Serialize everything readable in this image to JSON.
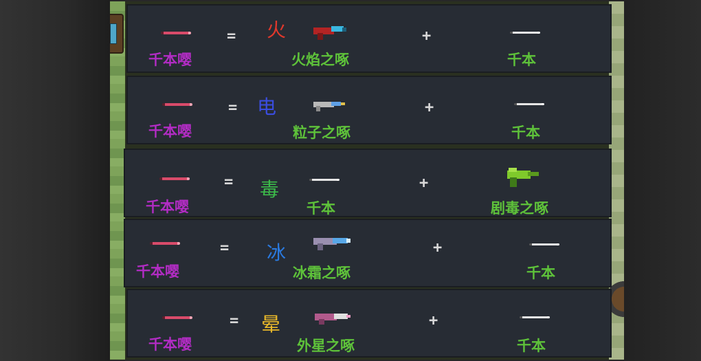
{
  "recipes": [
    {
      "result": "千本嘤",
      "equals": "=",
      "element": "火",
      "element_color": "#e0382c",
      "ingredient_a": "火焰之啄",
      "plus": "+",
      "ingredient_b": "千本",
      "gun_colors": [
        "#c52b2b",
        "#3ab7e0"
      ]
    },
    {
      "result": "千本嘤",
      "equals": "=",
      "element": "电",
      "element_color": "#3a4de0",
      "ingredient_a": "粒子之啄",
      "plus": "+",
      "ingredient_b": "千本",
      "gun_colors": [
        "#b9b9b9",
        "#5ea0e6"
      ]
    },
    {
      "result": "千本嘤",
      "equals": "=",
      "element": "毒",
      "element_color": "#3cba4a",
      "ingredient_a": "千本",
      "plus": "+",
      "ingredient_b": "剧毒之啄",
      "gun_colors": [
        "#7fc92b",
        "#3f7a19"
      ]
    },
    {
      "result": "千本嘤",
      "equals": "=",
      "element": "冰",
      "element_color": "#2a7ae0",
      "ingredient_a": "冰霜之啄",
      "plus": "+",
      "ingredient_b": "千本",
      "gun_colors": [
        "#9a8fb0",
        "#58a8e8"
      ]
    },
    {
      "result": "千本嘤",
      "equals": "=",
      "element": "晕",
      "element_color": "#e8b82a",
      "ingredient_a": "外星之啄",
      "plus": "+",
      "ingredient_b": "千本",
      "gun_colors": [
        "#b25a8c",
        "#e0e0e0"
      ]
    }
  ]
}
